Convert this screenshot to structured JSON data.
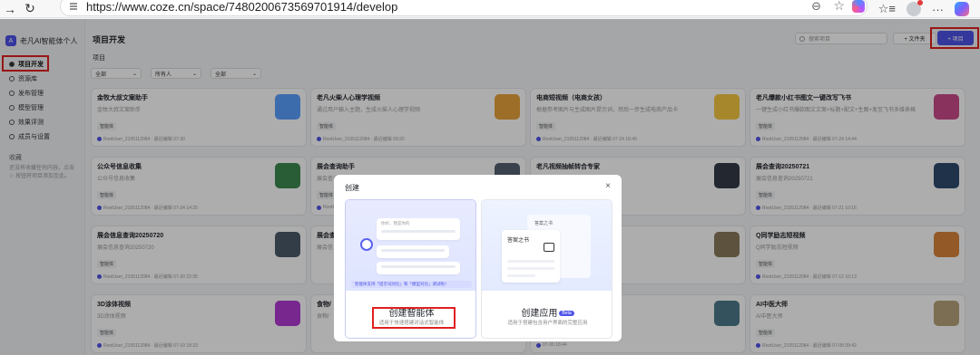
{
  "browser": {
    "url": "https://www.coze.cn/space/7480200673569701914/develop"
  },
  "sidebar": {
    "workspace": "老凡AI智能体个人",
    "items": [
      {
        "label": "项目开发",
        "active": true
      },
      {
        "label": "资源库"
      },
      {
        "label": "发布管理"
      },
      {
        "label": "模型管理"
      },
      {
        "label": "效果评测"
      },
      {
        "label": "成员与设置"
      }
    ],
    "favorites_title": "收藏",
    "favorites_text": "还没有收藏任何内容，点击 ☆ 按钮将项目添加至此。"
  },
  "header": {
    "title": "项目开发",
    "search_placeholder": "搜索项目",
    "folder_button": "+ 文件夹",
    "project_button": "+ 项目"
  },
  "section": {
    "label": "项目",
    "filters": [
      "全部",
      "所有人",
      "全部"
    ]
  },
  "cards": [
    {
      "title": "金牧大叔文案助手",
      "desc": "金牧大叔文案助手",
      "tag": "智能体",
      "meta": "RootUser_2105112084 · 最近编辑 07-30",
      "color": "#5aa0ff"
    },
    {
      "title": "老凡火柴人心理学视频",
      "desc": "通过用户输入主题，生成火柴人心理学视频",
      "tag": "智能体",
      "meta": "RootUser_2105112084 · 最近编辑 09:20",
      "color": "#e8a23b"
    },
    {
      "title": "电商短视频（电商女孩）",
      "desc": "根据参考图片与生成图片提示词，然后一步生成电商产品卡",
      "tag": "智能体",
      "meta": "RootUser_2105112084 · 最近编辑 07-24 16:40",
      "color": "#f5c842"
    },
    {
      "title": "老凡爆款小红书图文一键改写飞书",
      "desc": "一键生成小红书爆款图文文案+标题+配文+生图+发至飞书多维表格",
      "tag": "智能体",
      "meta": "RootUser_2105112084 · 最近编辑 07-24 14:44",
      "color": "#c94b8a"
    },
    {
      "title": "公众号信息收集",
      "desc": "公众号信息收集",
      "tag": "智能体",
      "meta": "RootUser_2105112084 · 最近编辑 07-24 14:25",
      "color": "#3d8a4e"
    },
    {
      "title": "展会查询助手",
      "desc": "展会查询助手",
      "tag": "智能体",
      "meta": "RootUser_2105112084",
      "color": "#556070"
    },
    {
      "title": "老凡视频抽帧转合专家",
      "desc": "",
      "tag": "",
      "meta": "07-23 10:11",
      "color": "#333a48"
    },
    {
      "title": "展会查询20250721",
      "desc": "展会信息查询20250721",
      "tag": "智能体",
      "meta": "RootUser_2105112084 · 最近编辑 07-21 10:16",
      "color": "#2f4a6e"
    },
    {
      "title": "展会信息查询20250720",
      "desc": "展会信息查询20250720",
      "tag": "智能体",
      "meta": "RootUser_2105112084 · 最近编辑 07-20 22:35",
      "color": "#4a5a6a"
    },
    {
      "title": "展会查",
      "desc": "展会信",
      "tag": "",
      "meta": "",
      "color": "#5a6a7a"
    },
    {
      "title": "",
      "desc": "",
      "tag": "",
      "meta": "07-16 14:43",
      "color": "#8a7a5a"
    },
    {
      "title": "Q同学励志短视频",
      "desc": "Q同学励志短视频",
      "tag": "智能体",
      "meta": "RootUser_2105112084 · 最近编辑 07-12 10:13",
      "color": "#d9853b"
    },
    {
      "title": "3D涂体视频",
      "desc": "3D涂体视频",
      "tag": "智能体",
      "meta": "RootUser_2105112084 · 最近编辑 07-10 18:33",
      "color": "#b03ad0"
    },
    {
      "title": "食物/",
      "desc": "食物/",
      "tag": "",
      "meta": "",
      "color": "#6a4a3a"
    },
    {
      "title": "",
      "desc": "",
      "tag": "",
      "meta": "07-09 18:44",
      "color": "#4d7a8a"
    },
    {
      "title": "AI中医大师",
      "desc": "AI中医大师",
      "tag": "智能体",
      "meta": "RootUser_2105112084 · 最近编辑 07-08 09:42",
      "color": "#b7a27a"
    }
  ],
  "modal": {
    "title": "创建",
    "agent": {
      "name": "创建智能体",
      "sub": "适用于快速搭建对话式智能体",
      "strip": "智能体支持「提示词对比」和「模型对比」调试啦！",
      "bubble_text": "你好，我是你的"
    },
    "app": {
      "name": "创建应用",
      "badge": "Beta",
      "sub": "适用于搭建包含用户界面的完整应用",
      "doc_title": "答案之书",
      "doc_back_title": "答案之书"
    }
  }
}
